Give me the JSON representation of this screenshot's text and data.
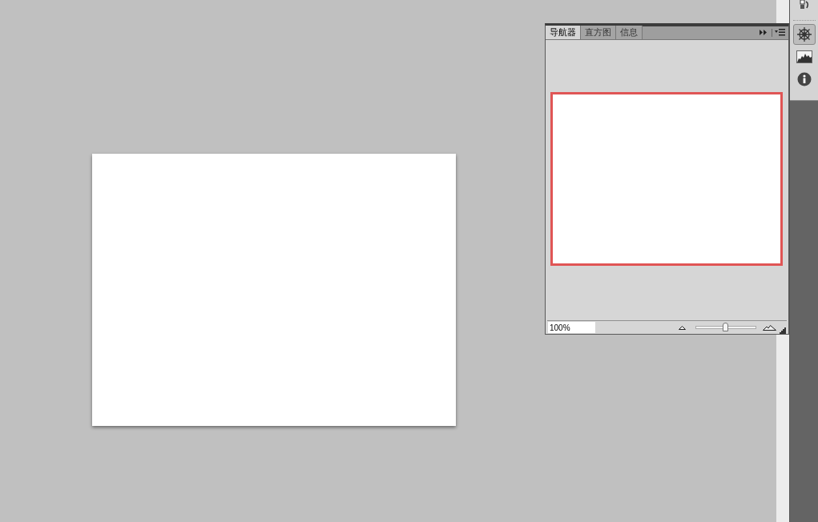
{
  "panel": {
    "tabs": [
      {
        "label": "导航器",
        "selected": true
      },
      {
        "label": "直方图",
        "selected": false
      },
      {
        "label": "信息",
        "selected": false
      }
    ],
    "zoom_field": {
      "value": "100%"
    },
    "zoom_slider": {
      "level": 0.5
    }
  },
  "dock": {
    "items": [
      {
        "kind": "navigator",
        "selected": true
      },
      {
        "kind": "histogram",
        "selected": false
      },
      {
        "kind": "info",
        "selected": false
      }
    ]
  }
}
